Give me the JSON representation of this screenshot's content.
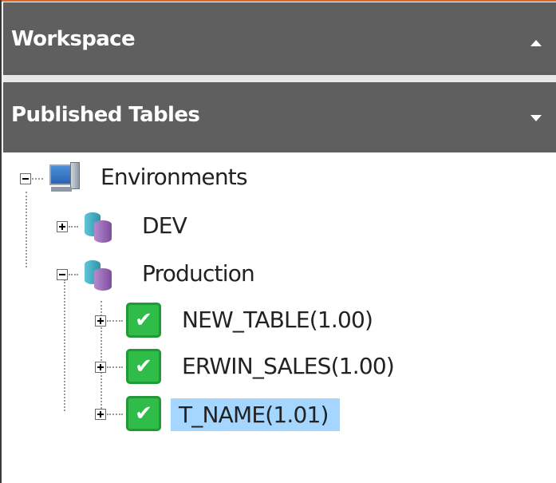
{
  "panels": {
    "workspace": {
      "title": "Workspace",
      "toggle_icon": "caret-up-icon"
    },
    "published": {
      "title": "Published Tables",
      "toggle_icon": "caret-down-icon"
    }
  },
  "tree": {
    "root": {
      "label": "Environments",
      "icon": "monitor-icon",
      "state": "expanded"
    },
    "environments": [
      {
        "label": "DEV",
        "icon": "database-icon",
        "state": "collapsed"
      },
      {
        "label": "Production",
        "icon": "database-icon",
        "state": "expanded"
      }
    ],
    "tables": [
      {
        "label": "NEW_TABLE(1.00)",
        "icon": "check-icon",
        "selected": false
      },
      {
        "label": "ERWIN_SALES(1.00)",
        "icon": "check-icon",
        "selected": false
      },
      {
        "label": "T_NAME(1.01)",
        "icon": "check-icon",
        "selected": true
      }
    ]
  },
  "colors": {
    "header_bg": "#5f5f5f",
    "accent": "#d9652a",
    "selection": "#a4d6ff",
    "check": "#2fbc48"
  }
}
